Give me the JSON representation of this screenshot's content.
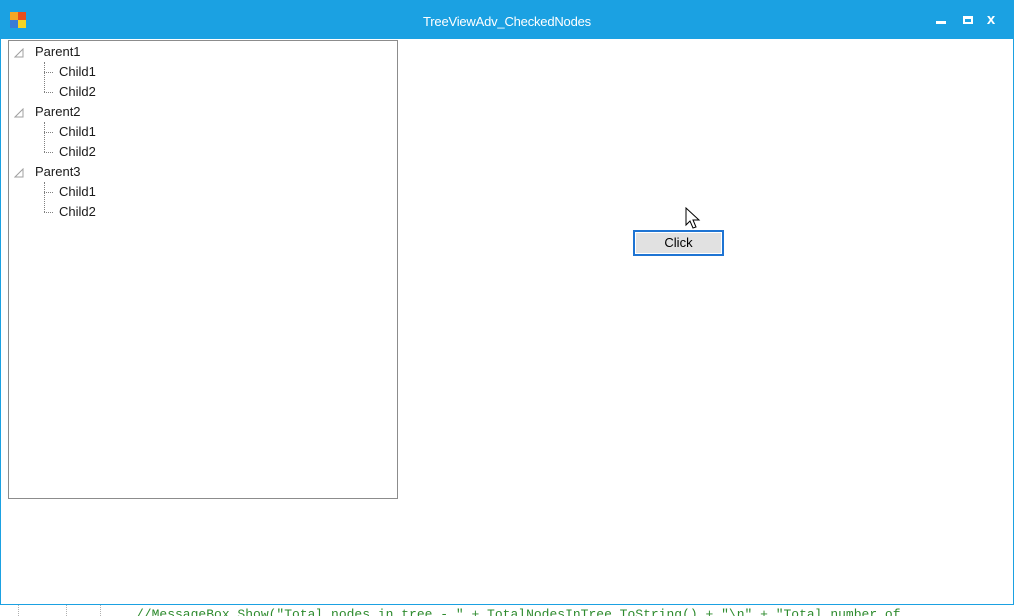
{
  "window": {
    "title": "TreeViewAdv_CheckedNodes",
    "controls": {
      "minimize": "–",
      "close": "x"
    },
    "accent_color": "#1ba1e2"
  },
  "tree": {
    "nodes": [
      {
        "label": "Parent1",
        "children": [
          {
            "label": "Child1"
          },
          {
            "label": "Child2"
          }
        ]
      },
      {
        "label": "Parent2",
        "children": [
          {
            "label": "Child1"
          },
          {
            "label": "Child2"
          }
        ]
      },
      {
        "label": "Parent3",
        "children": [
          {
            "label": "Child1"
          },
          {
            "label": "Child2"
          }
        ]
      }
    ]
  },
  "button": {
    "label": "Click"
  },
  "code_editor": {
    "partial_line": "//MessageBox.Show(\"Total nodes in tree - \" + TotalNodesInTree.ToString() + \"\\n\" + \"Total number of"
  }
}
